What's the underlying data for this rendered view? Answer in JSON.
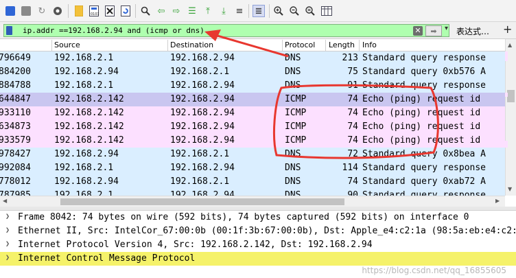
{
  "filter": {
    "expression": "ip.addr ==192.168.2.94 and (icmp or dns)",
    "expression_label": "表达式…",
    "clear_glyph": "✕",
    "apply_glyph": "➡",
    "dropdown_glyph": "▾",
    "plus_glyph": "+"
  },
  "columns": {
    "source": "Source",
    "destination": "Destination",
    "protocol": "Protocol",
    "length": "Length",
    "info": "Info"
  },
  "packets": [
    {
      "no": "796649",
      "src": "192.168.2.1",
      "dst": "192.168.2.94",
      "proto": "DNS",
      "len": "213",
      "info": "Standard query response",
      "bg": "#daeeff"
    },
    {
      "no": "884200",
      "src": "192.168.2.94",
      "dst": "192.168.2.1",
      "proto": "DNS",
      "len": "75",
      "info": "Standard query 0xb576 A",
      "bg": "#daeeff"
    },
    {
      "no": "884788",
      "src": "192.168.2.1",
      "dst": "192.168.2.94",
      "proto": "DNS",
      "len": "91",
      "info": "Standard query response",
      "bg": "#daeeff"
    },
    {
      "no": "644847",
      "src": "192.168.2.142",
      "dst": "192.168.2.94",
      "proto": "ICMP",
      "len": "74",
      "info": "Echo (ping) request  id",
      "bg": "#c9c6f0"
    },
    {
      "no": "933110",
      "src": "192.168.2.142",
      "dst": "192.168.2.94",
      "proto": "ICMP",
      "len": "74",
      "info": "Echo (ping) request  id",
      "bg": "#fce0ff"
    },
    {
      "no": "634873",
      "src": "192.168.2.142",
      "dst": "192.168.2.94",
      "proto": "ICMP",
      "len": "74",
      "info": "Echo (ping) request  id",
      "bg": "#fce0ff"
    },
    {
      "no": "933579",
      "src": "192.168.2.142",
      "dst": "192.168.2.94",
      "proto": "ICMP",
      "len": "74",
      "info": "Echo (ping) request  id",
      "bg": "#fce0ff"
    },
    {
      "no": "978427",
      "src": "192.168.2.94",
      "dst": "192.168.2.1",
      "proto": "DNS",
      "len": "72",
      "info": "Standard query 0x8bea A",
      "bg": "#daeeff"
    },
    {
      "no": "992084",
      "src": "192.168.2.1",
      "dst": "192.168.2.94",
      "proto": "DNS",
      "len": "114",
      "info": "Standard query response",
      "bg": "#daeeff"
    },
    {
      "no": "778012",
      "src": "192.168.2.94",
      "dst": "192.168.2.1",
      "proto": "DNS",
      "len": "74",
      "info": "Standard query 0xab72 A",
      "bg": "#daeeff"
    },
    {
      "no": "787985",
      "src": "192.168.2.1",
      "dst": "192.168.2.94",
      "proto": "DNS",
      "len": "90",
      "info": "Standard query response",
      "bg": "#daeeff"
    }
  ],
  "details": [
    {
      "text": "Frame 8042: 74 bytes on wire (592 bits), 74 bytes captured (592 bits) on interface 0",
      "selected": false
    },
    {
      "text": "Ethernet II, Src: IntelCor_67:00:0b (00:1f:3b:67:00:0b), Dst: Apple_e4:c2:1a (98:5a:eb:e4:c2:1a)",
      "selected": false
    },
    {
      "text": "Internet Protocol Version 4, Src: 192.168.2.142, Dst: 192.168.2.94",
      "selected": false
    },
    {
      "text": "Internet Control Message Protocol",
      "selected": true
    }
  ],
  "watermark": "https://blog.csdn.net/qq_16855605",
  "colors": {
    "filter_valid": "#afffaf",
    "dns_row": "#daeeff",
    "icmp_row": "#fce0ff",
    "selected_row": "#c9c6f0",
    "selected_detail": "#f5f26a",
    "annotation_red": "#e8372f"
  }
}
